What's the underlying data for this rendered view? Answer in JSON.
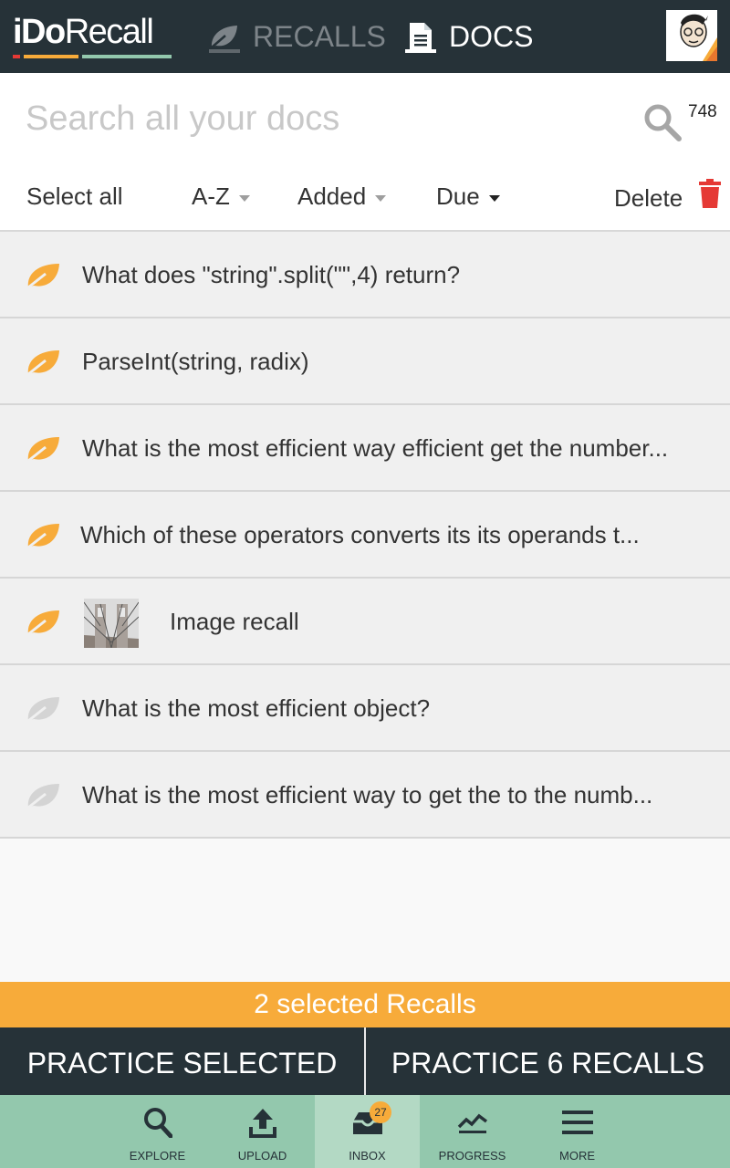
{
  "header": {
    "logo_part1": "iDo",
    "logo_part2": "Recall",
    "tabs": [
      {
        "label": "RECALLS",
        "icon": "leaf-icon",
        "active": false
      },
      {
        "label": "DOCS",
        "icon": "document-icon",
        "active": true
      }
    ],
    "colors": {
      "bar": "#263238",
      "accent": "#f7ab3a"
    }
  },
  "search": {
    "placeholder": "Search all your docs",
    "value": "",
    "count": "748"
  },
  "toolbar": {
    "select_all": "Select all",
    "sort_az": "A-Z",
    "sort_added": "Added",
    "sort_due": "Due",
    "delete": "Delete"
  },
  "items": [
    {
      "title": "What does \"string\".split(\"\",4) return?",
      "leaf_color": "#f7ab3a"
    },
    {
      "title": "ParseInt(string, radix)",
      "leaf_color": "#f7ab3a"
    },
    {
      "title": "What is the most efficient way efficient get the number...",
      "leaf_color": "#f7ab3a"
    },
    {
      "title": "Which of these operators converts its its operands t...",
      "leaf_color": "#f7ab3a"
    },
    {
      "title": "Image recall",
      "leaf_color": "#f7ab3a",
      "has_thumbnail": true
    },
    {
      "title": "What is the most efficient object?",
      "leaf_color": "#d4d4d4"
    },
    {
      "title": "What is the most efficient way to get the to  the numb...",
      "leaf_color": "#d4d4d4"
    }
  ],
  "selection": {
    "text": "2 selected Recalls"
  },
  "actions": {
    "practice_selected": "PRACTICE SELECTED",
    "practice_all": "PRACTICE 6 RECALLS"
  },
  "nav": {
    "items": [
      {
        "label": "EXPLORE",
        "icon": "search-icon"
      },
      {
        "label": "UPLOAD",
        "icon": "upload-icon"
      },
      {
        "label": "INBOX",
        "icon": "inbox-icon",
        "active": true
      },
      {
        "label": "PROGRESS",
        "icon": "trending-icon"
      },
      {
        "label": "MORE",
        "icon": "menu-icon"
      }
    ],
    "inbox_badge": "27"
  }
}
